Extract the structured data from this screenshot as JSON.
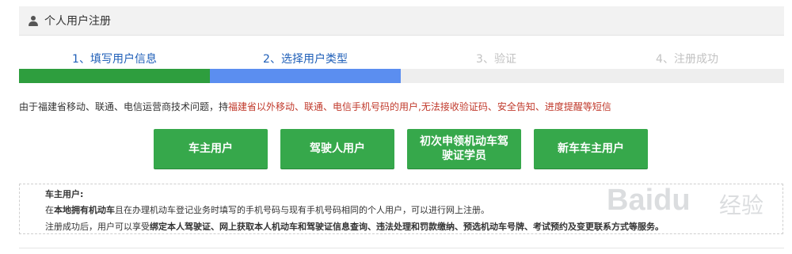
{
  "header": {
    "title": "个人用户注册",
    "icon": "user-icon"
  },
  "steps": [
    {
      "label": "1、填写用户信息",
      "state": "done"
    },
    {
      "label": "2、选择用户类型",
      "state": "current"
    },
    {
      "label": "3、验证",
      "state": "pending"
    },
    {
      "label": "4、注册成功",
      "state": "pending"
    }
  ],
  "progress": {
    "done_color": "#2e9e3e",
    "current_color": "#5b8ef0",
    "pending_color": "#eeeeee"
  },
  "notice": {
    "part1": "由于福建省移动、联通、电信运营商技术问题，持",
    "part2": "福建省以外移动、联通、电信手机号码的用户,无法接收验证码、安全告知、进度提醒等短信"
  },
  "buttons": [
    {
      "label": "车主用户"
    },
    {
      "label": "驾驶人用户"
    },
    {
      "label": "初次申领机动车驾驶证学员"
    },
    {
      "label": "新车车主用户"
    }
  ],
  "description": {
    "heading": "车主用户:",
    "line1_prefix": "在",
    "line1_bold": "本地拥有机动车",
    "line1_rest": "且在办理机动车登记业务时填写的手机号码与现有手机号码相同的个人用户，可以进行网上注册。",
    "line2_prefix": "注册成功后，用户可以享受",
    "line2_bold": "绑定本人驾驶证、网上获取本人机动车和驾驶证信息查询、违法处理和罚款缴纳、预选机动车号牌、考试预约及变更联系方式等服务。"
  },
  "watermark": {
    "text": "Bai",
    "text2": "du",
    "cn": "经验"
  },
  "colors": {
    "button_green": "#36a84b",
    "step_active_text": "#1f5fb8",
    "notice_red": "#c0392b"
  }
}
